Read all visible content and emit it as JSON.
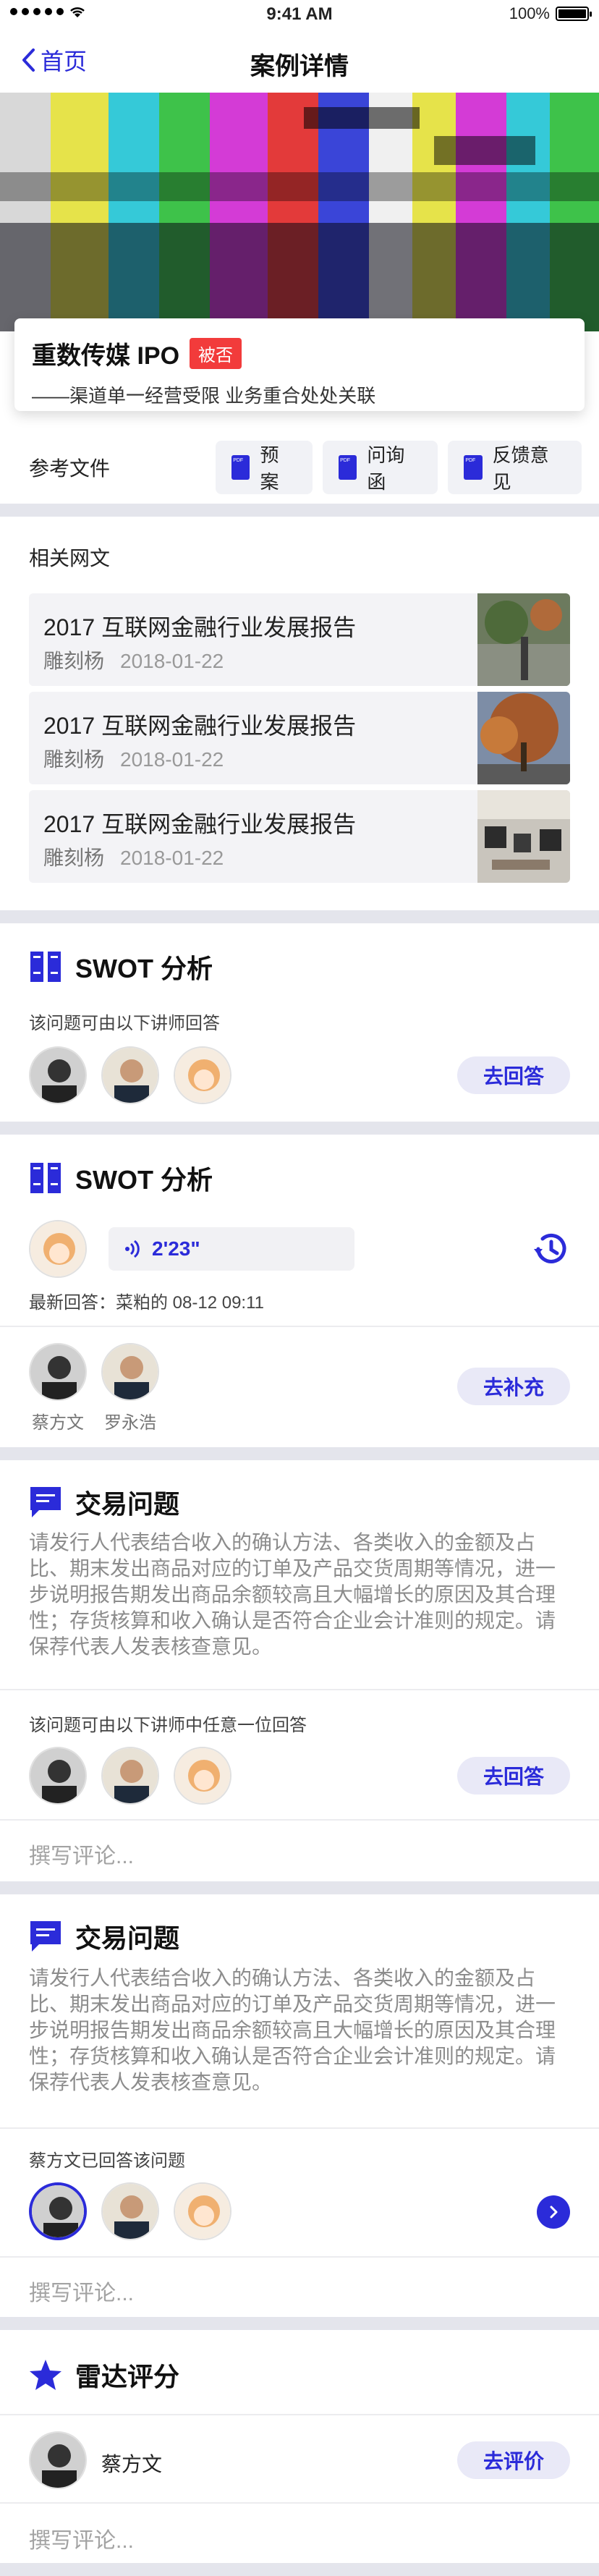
{
  "status_bar": {
    "time": "9:41 AM",
    "battery": "100%",
    "battery_level": 1.0
  },
  "nav": {
    "back_label": "首页",
    "title": "案例详情"
  },
  "case": {
    "title": "重数传媒 IPO",
    "badge": "被否",
    "subtitle": "——渠道单一经营受限 业务重合处处关联"
  },
  "references": {
    "label": "参考文件",
    "items": [
      "预案",
      "问询函",
      "反馈意见"
    ]
  },
  "articles": {
    "heading": "相关网文",
    "items": [
      {
        "title": "2017 互联网金融行业发展报告",
        "author": "雕刻杨",
        "date": "2018-01-22"
      },
      {
        "title": "2017 互联网金融行业发展报告",
        "author": "雕刻杨",
        "date": "2018-01-22"
      },
      {
        "title": "2017 互联网金融行业发展报告",
        "author": "雕刻杨",
        "date": "2018-01-22"
      }
    ]
  },
  "swot1": {
    "title": "SWOT 分析",
    "note": "该问题可由以下讲师回答",
    "action": "去回答"
  },
  "swot2": {
    "title": "SWOT 分析",
    "voice_duration": "2'23\"",
    "latest": "最新回答：菜粕的 08-12 09:11",
    "names": [
      "蔡方文",
      "罗永浩"
    ],
    "action": "去补充"
  },
  "trade1": {
    "title": "交易问题",
    "text": "请发行人代表结合收入的确认方法、各类收入的金额及占比、期末发出商品对应的订单及产品交货周期等情况，进一步说明报告期发出商品余额较高且大幅增长的原因及其合理性；存货核算和收入确认是否符合企业会计准则的规定。请保荐代表人发表核查意见。",
    "note": "该问题可由以下讲师中任意一位回答",
    "action": "去回答",
    "comment_placeholder": "撰写评论..."
  },
  "trade2": {
    "title": "交易问题",
    "text": "请发行人代表结合收入的确认方法、各类收入的金额及占比、期末发出商品对应的订单及产品交货周期等情况，进一步说明报告期发出商品余额较高且大幅增长的原因及其合理性；存货核算和收入确认是否符合企业会计准则的规定。请保荐代表人发表核查意见。",
    "note": "蔡方文已回答该问题",
    "comment_placeholder": "撰写评论..."
  },
  "radar": {
    "title": "雷达评分",
    "person": "蔡方文",
    "action": "去评价",
    "comment_placeholder": "撰写评论..."
  },
  "colors": {
    "accent": "#2b2bd9",
    "badge": "#f23b3b",
    "divider": "#e4e5ec"
  },
  "icons": [
    "wifi-icon",
    "back-chevron-icon",
    "pdf-icon",
    "swot-icon",
    "audio-wave-icon",
    "history-icon",
    "chat-icon",
    "next-arrow-icon",
    "star-icon"
  ]
}
